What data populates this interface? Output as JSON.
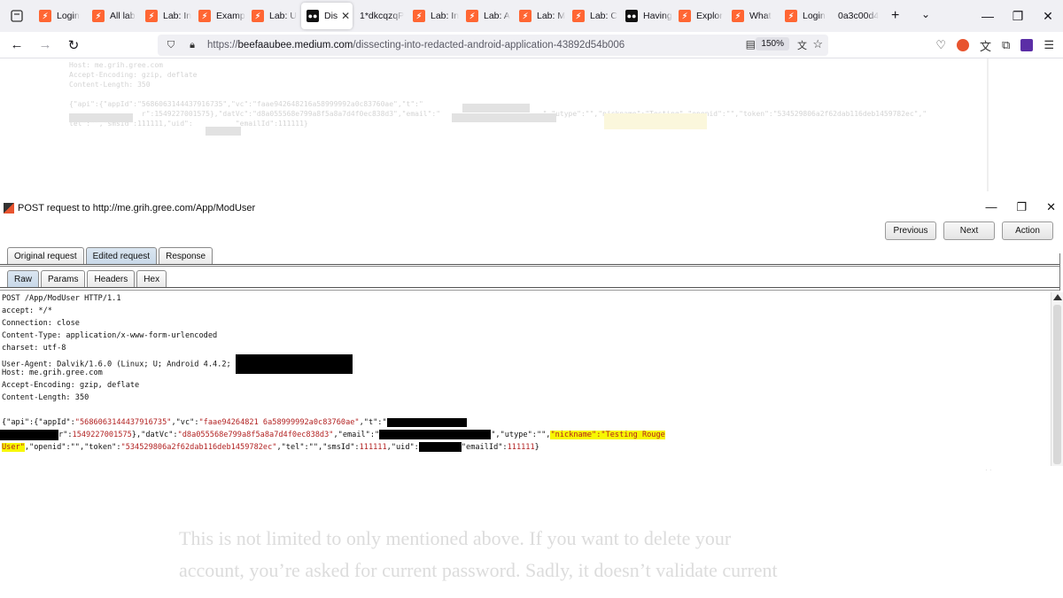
{
  "browser": {
    "tabs": [
      {
        "label": "Login",
        "icon": "burp"
      },
      {
        "label": "All lab",
        "icon": "burp"
      },
      {
        "label": "Lab: In",
        "icon": "burp"
      },
      {
        "label": "Examp",
        "icon": "burp"
      },
      {
        "label": "Lab: U",
        "icon": "burp"
      },
      {
        "label": "Dis",
        "icon": "medium",
        "active": true
      },
      {
        "label": "1*dkcqzqP",
        "icon": "none"
      },
      {
        "label": "Lab: In",
        "icon": "burp"
      },
      {
        "label": "Lab: A",
        "icon": "burp"
      },
      {
        "label": "Lab: M",
        "icon": "burp"
      },
      {
        "label": "Lab: C",
        "icon": "burp"
      },
      {
        "label": "Having",
        "icon": "medium"
      },
      {
        "label": "Explor",
        "icon": "burp"
      },
      {
        "label": "What",
        "icon": "burp"
      },
      {
        "label": "Login",
        "icon": "burp"
      },
      {
        "label": "0a3c00d4",
        "icon": "none"
      }
    ],
    "url_prefix": "https://",
    "url_domain": "beefaaubee.medium.com",
    "url_path": "/dissecting-into-redacted-android-application-43892d54b006",
    "zoom": "150%"
  },
  "background": {
    "article_lines": [
      "This is not limited to only mentioned above. If you want to delete your",
      "account, you’re asked for current password. Sadly, it doesn’t validate current"
    ]
  },
  "burp": {
    "title": "POST request to http://me.grih.gree.com/App/ModUser",
    "buttons": {
      "previous": "Previous",
      "next": "Next",
      "action": "Action"
    },
    "tabs_top": [
      "Original request",
      "Edited request",
      "Response"
    ],
    "tabs_view": [
      "Raw",
      "Params",
      "Headers",
      "Hex"
    ],
    "request": {
      "line1": "POST /App/ModUser HTTP/1.1",
      "line2": "accept: */*",
      "line3": "Connection: close",
      "line4": "Content-Type: application/x-www-form-urlencoded",
      "line5": "charset: utf-8",
      "line6": "User-Agent: Dalvik/1.6.0 (Linux; U; Android 4.4.2; ",
      "line7": "Host: me.grih.gree.com",
      "line8": "Accept-Encoding: gzip, deflate",
      "line9": "Content-Length: 350"
    },
    "body": {
      "p1": "{\"api\":{\"appId\":",
      "v_appid": "\"5686063144437916735\"",
      "p2": ",\"vc\":",
      "v_vc": "\"faae94264821 6a58999992a0c83760ae\"",
      "p3": ",\"t\":\"",
      "p4": "r\":",
      "v_r": "1549227001575",
      "p5": "},\"datVc\":",
      "v_datvc": "\"d8a055568e799a8f5a8a7d4f0ec838d3\"",
      "p6": ",\"email\":\"",
      "p7": "\",\"utype\":\"\",",
      "v_nick": "\"nickname\":\"Testing Rouge",
      "v_nick2": "User\"",
      "p8": ",\"openid\":\"\",\"token\":",
      "v_token": "\"534529806a2f62dab116deb1459782ec\"",
      "p9": ",\"tel\":\"\",\"smsId\":",
      "v_sms": "111111",
      "p10": ",\"uid\":",
      "p11": "\"emailId\":",
      "v_eid": "111111",
      "p12": "}"
    }
  },
  "colors": {
    "key": "#111111",
    "value": "#b22222",
    "highlight": "#f7f700",
    "burp_accent": "#e8542f"
  }
}
